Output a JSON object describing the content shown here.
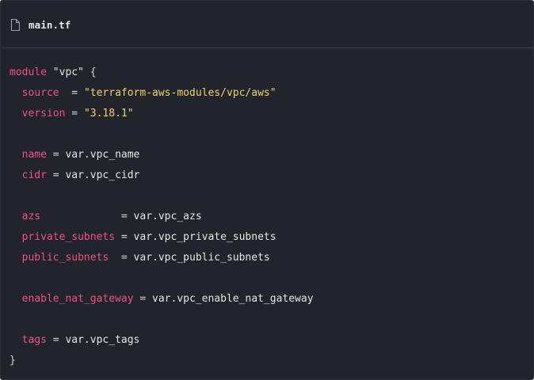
{
  "header": {
    "filename": "main.tf",
    "icon": "file-icon"
  },
  "code": {
    "module_keyword": "module",
    "module_name": "\"vpc\"",
    "open_brace": "{",
    "close_brace": "}",
    "lines": {
      "source": {
        "key": "source",
        "pad": "  ",
        "op": "= ",
        "value": "\"terraform-aws-modules/vpc/aws\""
      },
      "version": {
        "key": "version",
        "pad": " ",
        "op": "= ",
        "value": "\"3.18.1\""
      },
      "name": {
        "key": "name",
        "pad": " ",
        "op": "= ",
        "value": "var.vpc_name"
      },
      "cidr": {
        "key": "cidr",
        "pad": " ",
        "op": "= ",
        "value": "var.vpc_cidr"
      },
      "azs": {
        "key": "azs",
        "pad": "             ",
        "op": "= ",
        "value": "var.vpc_azs"
      },
      "private_subnets": {
        "key": "private_subnets",
        "pad": " ",
        "op": "= ",
        "value": "var.vpc_private_subnets"
      },
      "public_subnets": {
        "key": "public_subnets",
        "pad": "  ",
        "op": "= ",
        "value": "var.vpc_public_subnets"
      },
      "enable_nat_gateway": {
        "key": "enable_nat_gateway",
        "pad": " ",
        "op": "= ",
        "value": "var.vpc_enable_nat_gateway"
      },
      "tags": {
        "key": "tags",
        "pad": " ",
        "op": "= ",
        "value": "var.vpc_tags"
      }
    }
  },
  "colors": {
    "background": "#22242c",
    "keyword": "#f0508a",
    "string": "#f1d36e",
    "text": "#d6d6d6"
  }
}
